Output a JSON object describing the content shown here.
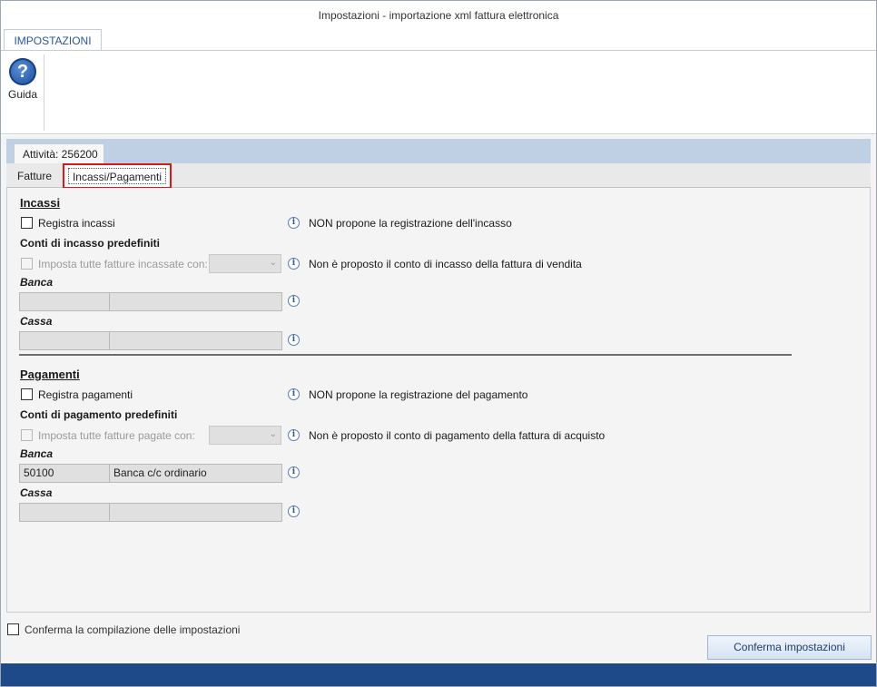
{
  "window": {
    "title": "Impostazioni - importazione xml fattura elettronica"
  },
  "ribbon": {
    "tab_label": "IMPOSTAZIONI",
    "help_label": "Guida",
    "help_glyph": "?"
  },
  "document": {
    "tab_label": "Attività: 256200"
  },
  "inner_tabs": [
    {
      "label": "Fatture",
      "selected": false
    },
    {
      "label": "Incassi/Pagamenti",
      "selected": true
    }
  ],
  "incassi": {
    "section_title": "Incassi",
    "register_label": "Registra incassi",
    "register_checked": false,
    "register_info": "NON propone la registrazione dell'incasso",
    "conti_title": "Conti di incasso predefiniti",
    "set_all_label": "Imposta tutte fatture incassate con:",
    "set_all_checked": false,
    "set_all_info": "Non è proposto il conto di incasso della fattura di vendita",
    "combo_value": "",
    "banca_label": "Banca",
    "banca_code": "",
    "banca_desc": "",
    "cassa_label": "Cassa",
    "cassa_code": "",
    "cassa_desc": ""
  },
  "pagamenti": {
    "section_title": "Pagamenti",
    "register_label": "Registra pagamenti",
    "register_checked": false,
    "register_info": "NON propone la registrazione del pagamento",
    "conti_title": "Conti di pagamento predefiniti",
    "set_all_label": "Imposta tutte fatture pagate con:",
    "set_all_checked": false,
    "set_all_info": "Non è proposto il conto di pagamento della fattura di acquisto",
    "combo_value": "",
    "banca_label": "Banca",
    "banca_code": "50100",
    "banca_desc": "Banca c/c ordinario",
    "cassa_label": "Cassa",
    "cassa_code": "",
    "cassa_desc": ""
  },
  "footer": {
    "confirm_checkbox_label": "Conferma la compilazione delle impostazioni",
    "confirm_checked": false,
    "confirm_button": "Conferma impostazioni"
  },
  "colors": {
    "accent": "#2b5797",
    "highlight_border": "#d61a1a",
    "statusbar": "#1f4a8a",
    "header": "#c0d0e4"
  },
  "icons": {
    "help": "question-circle-icon",
    "info": "info-circle-icon",
    "dropdown": "chevron-down-icon"
  }
}
